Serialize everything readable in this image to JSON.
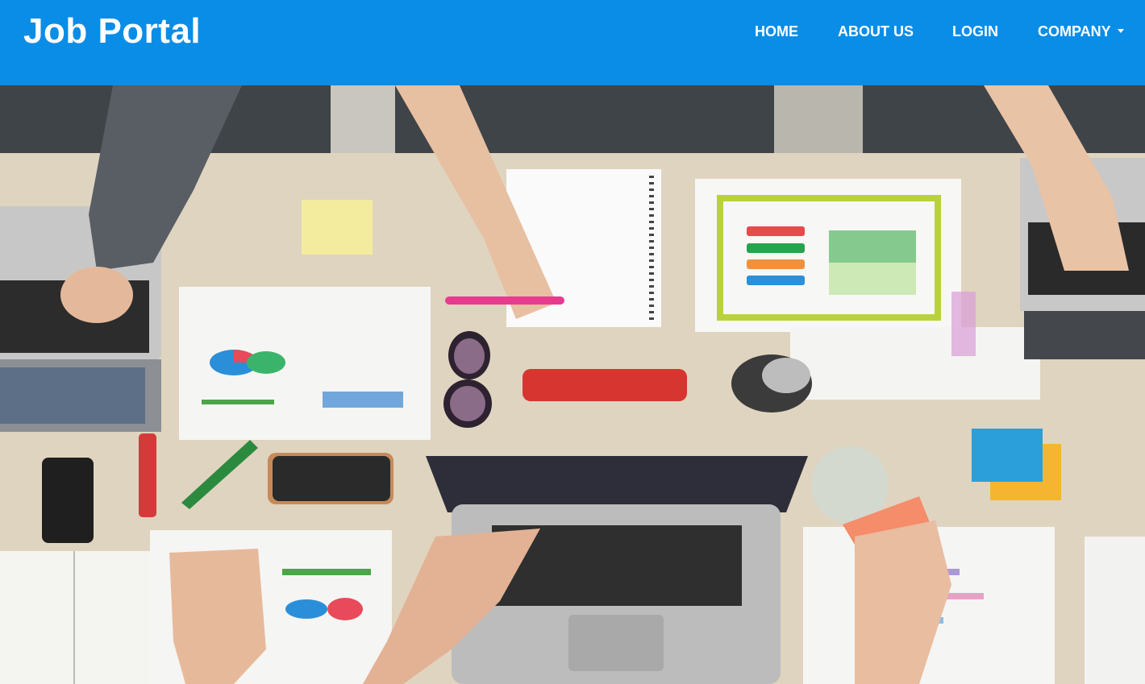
{
  "navbar": {
    "brand": "Job Portal",
    "items": [
      {
        "label": "HOME"
      },
      {
        "label": "ABOUT US"
      },
      {
        "label": "LOGIN"
      },
      {
        "label": "COMPANY",
        "dropdown": true
      }
    ],
    "background": "#0a8de6"
  },
  "hero": {
    "image": "team-desk-with-laptops-and-charts"
  }
}
